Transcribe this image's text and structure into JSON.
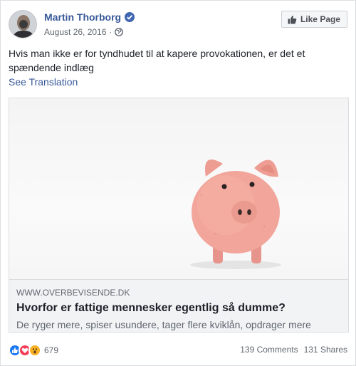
{
  "post": {
    "author": "Martin Thorborg",
    "date": "August 26, 2016",
    "separator": "·",
    "like_page_label": "Like Page",
    "text": "Hvis man ikke er for tyndhudet til at kapere provokationen, er det et spændende indlæg",
    "see_translation": "See Translation"
  },
  "link": {
    "domain": "WWW.OVERBEVISENDE.DK",
    "title": "Hvorfor er fattige mennesker egentlig så dumme?",
    "description": "De ryger mere, spiser usundere, tager flere kviklån, opdrager mere"
  },
  "footer": {
    "reaction_count": "679",
    "comments": "139 Comments",
    "shares": "131 Shares"
  },
  "icons": {
    "verified": "verified-badge-icon",
    "privacy": "globe-icon",
    "like_page": "thumbs-up-icon",
    "reactions": [
      "like-reaction-icon",
      "love-reaction-icon",
      "wow-reaction-icon"
    ]
  },
  "colors": {
    "link_blue": "#385898",
    "verified_blue": "#4267b2",
    "like_blue": "#1877f2",
    "love_red": "#f33e58",
    "wow_yellow": "#f7b125"
  }
}
